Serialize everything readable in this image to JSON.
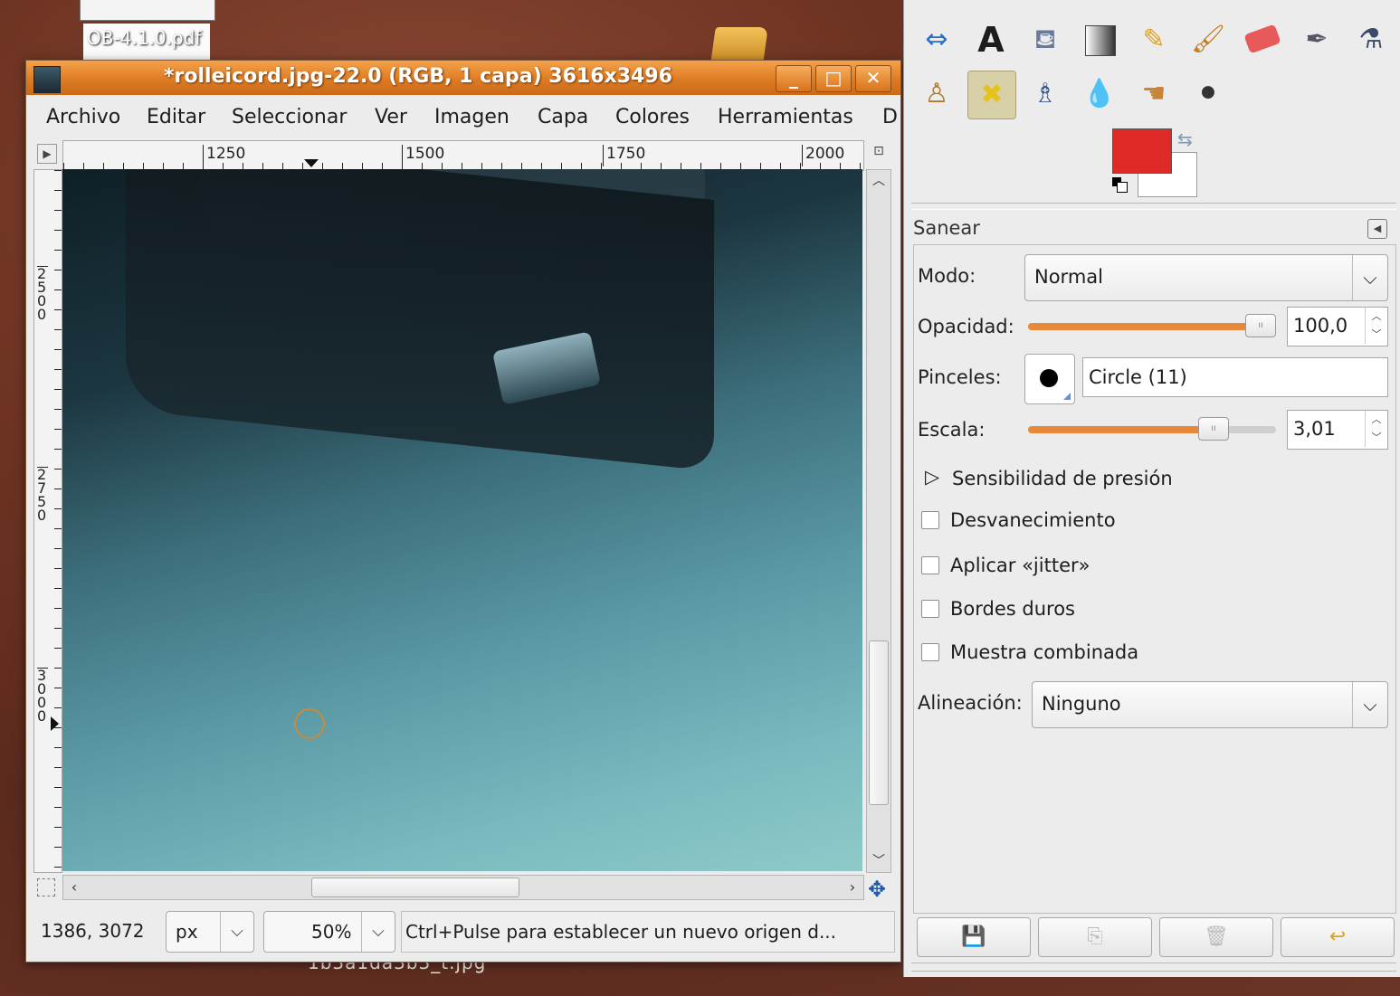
{
  "desktop": {
    "file_top_label": "OB-4.1.0.pdf",
    "file_bottom_label": "1b3a1da3b3_t.jpg"
  },
  "image_window": {
    "title": "*rolleicord.jpg-22.0 (RGB, 1 capa) 3616x3496",
    "buttons": {
      "minimize": "_",
      "maximize": "□",
      "close": "✕"
    },
    "menu": [
      "Archivo",
      "Editar",
      "Seleccionar",
      "Ver",
      "Imagen",
      "Capa",
      "Colores",
      "Herramientas",
      "D"
    ],
    "hruler_labels": [
      "1250",
      "1500",
      "1750",
      "2000"
    ],
    "vruler_labels": [
      "2500",
      "2750",
      "3000"
    ],
    "status": {
      "coords": "1386, 3072",
      "unit": "px",
      "zoom": "50%",
      "message": "Ctrl+Pulse para establecer un nuevo origen d..."
    }
  },
  "toolbox": {
    "tools_row1": [
      "flip-tool",
      "text-tool",
      "bucket-fill-tool",
      "blend-tool",
      "pencil-tool",
      "paintbrush-tool",
      "eraser-tool",
      "airbrush-tool",
      "ink-tool"
    ],
    "tools_row2": [
      "clone-tool",
      "heal-tool",
      "perspective-clone-tool",
      "blur-tool",
      "smudge-tool",
      "dodge-burn-tool"
    ],
    "active_tool": "heal-tool",
    "fg_color": "#e02a2a",
    "bg_color": "#ffffff",
    "options": {
      "title": "Sanear",
      "mode_label": "Modo:",
      "mode_value": "Normal",
      "opacity_label": "Opacidad:",
      "opacity_value": "100,0",
      "opacity_fraction": 1.0,
      "brush_label": "Pinceles:",
      "brush_value": "Circle (11)",
      "scale_label": "Escala:",
      "scale_value": "3,01",
      "scale_fraction": 0.81,
      "pressure_label": "Sensibilidad de presión",
      "fade_label": "Desvanecimiento",
      "jitter_label": "Aplicar «jitter»",
      "hard_edges_label": "Bordes duros",
      "sample_merged_label": "Muestra combinada",
      "alignment_label": "Alineación:",
      "alignment_value": "Ninguno"
    }
  }
}
